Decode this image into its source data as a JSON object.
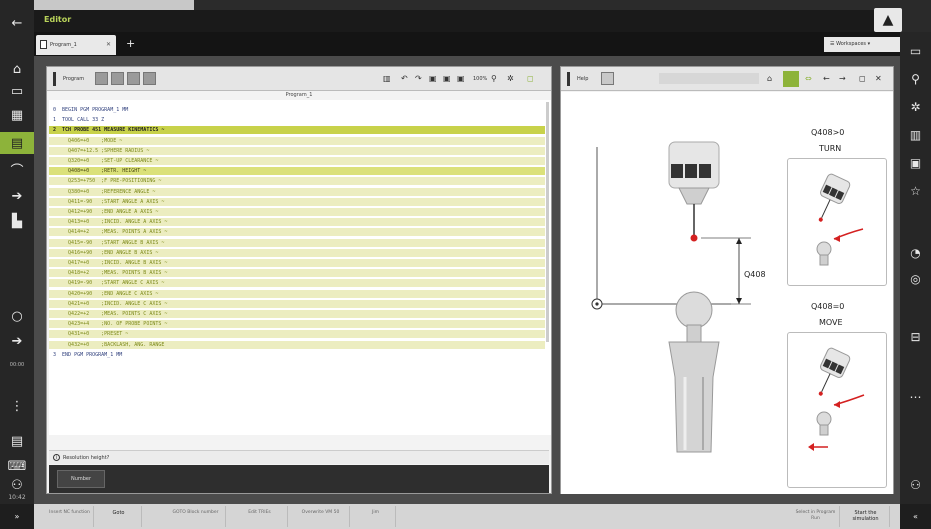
{
  "app": {
    "title": "Editor",
    "tab_label": "Program_1",
    "workspaces_label": "Workspaces"
  },
  "program_panel": {
    "label": "Program",
    "zoom": "100%",
    "file_title": "Program_1",
    "hint": "Resolution height?",
    "number_button": "Number",
    "lines": [
      {
        "text": "0  BEGIN PGM PROGRAM_1 MM",
        "style": "plain"
      },
      {
        "text": "1  TOOL CALL 33 Z",
        "style": "plain"
      },
      {
        "text": "2  TCH PROBE 451 MEASURE KINEMATICS ~",
        "style": "strong"
      },
      {
        "text": "     Q406=+0    ;MODE ~",
        "style": "block"
      },
      {
        "text": "     Q407=+12.5 ;SPHERE RADIUS ~",
        "style": "block"
      },
      {
        "text": "     Q320=+0    ;SET-UP CLEARANCE ~",
        "style": "block"
      },
      {
        "text": "     Q408=+0    ;RETR. HEIGHT ~",
        "style": "mid"
      },
      {
        "text": "     Q253=+750  ;F PRE-POSITIONING ~",
        "style": "block"
      },
      {
        "text": "     Q380=+0    ;REFERENCE ANGLE ~",
        "style": "block"
      },
      {
        "text": "     Q411=-90   ;START ANGLE A AXIS ~",
        "style": "block"
      },
      {
        "text": "     Q412=+90   ;END ANGLE A AXIS ~",
        "style": "block"
      },
      {
        "text": "     Q413=+0    ;INCID. ANGLE A AXIS ~",
        "style": "block"
      },
      {
        "text": "     Q414=+2    ;MEAS. POINTS A AXIS ~",
        "style": "block"
      },
      {
        "text": "     Q415=-90   ;START ANGLE B AXIS ~",
        "style": "block"
      },
      {
        "text": "     Q416=+90   ;END ANGLE B AXIS ~",
        "style": "block"
      },
      {
        "text": "     Q417=+0    ;INCID. ANGLE B AXIS ~",
        "style": "block"
      },
      {
        "text": "     Q418=+2    ;MEAS. POINTS B AXIS ~",
        "style": "block"
      },
      {
        "text": "     Q419=-90   ;START ANGLE C AXIS ~",
        "style": "block"
      },
      {
        "text": "     Q420=+90   ;END ANGLE C AXIS ~",
        "style": "block"
      },
      {
        "text": "     Q421=+0    ;INCID. ANGLE C AXIS ~",
        "style": "block"
      },
      {
        "text": "     Q422=+2    ;MEAS. POINTS C AXIS ~",
        "style": "block"
      },
      {
        "text": "     Q423=+4    ;NO. OF PROBE POINTS ~",
        "style": "block"
      },
      {
        "text": "     Q431=+0    ;PRESET ~",
        "style": "block"
      },
      {
        "text": "     Q432=+0    ;BACKLASH, ANG. RANGE",
        "style": "block"
      },
      {
        "text": "3  END PGM PROGRAM_1 MM",
        "style": "plain"
      }
    ]
  },
  "help_panel": {
    "label": "Help",
    "dimension_label": "Q408",
    "turn_caption_1": "Q408>0",
    "turn_caption_2": "TURN",
    "move_caption_1": "Q408=0",
    "move_caption_2": "MOVE"
  },
  "bottom_bar": {
    "buttons": [
      "Insert NC function",
      "Goto",
      "GOTO Block number",
      "Edit TRIEs",
      "Overwrite VM 50",
      "Jim"
    ],
    "right_buttons": [
      "Select in Program Run",
      "Start the simulation"
    ]
  },
  "left_bar": {
    "clock": "10:42"
  },
  "colors": {
    "accent_green": "#8db33a",
    "code_blue": "#3b4a9a",
    "highlight_yellow": "#c8d24a"
  }
}
